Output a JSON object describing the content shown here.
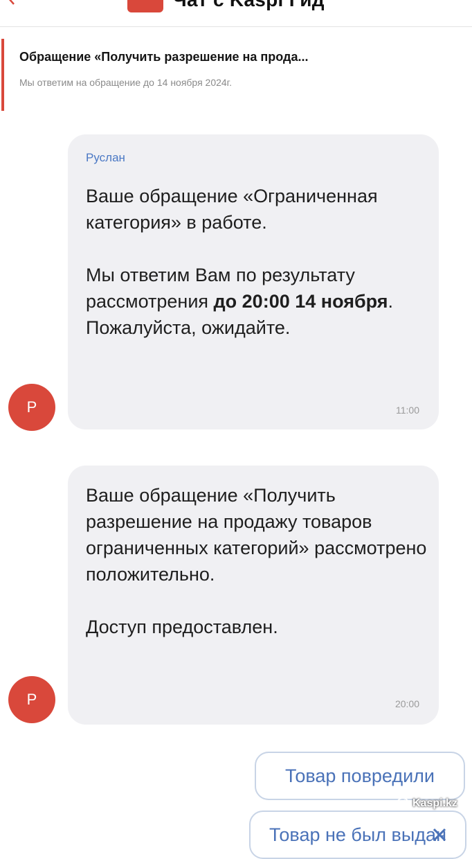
{
  "header": {
    "title": "Чат с Kaspi Гид",
    "back_icon": "arrow-back-icon",
    "chat_icon": "chat-bubble-icon"
  },
  "appeal": {
    "title": "Обращение «Получить разрешение на прода...",
    "subtitle": "Мы ответим на обращение до 14 ноября 2024г."
  },
  "messages": [
    {
      "sender": "Руслан",
      "avatar_letter": "Р",
      "line1": "Ваше обращение «Ограниченная категория» в работе.",
      "line2_start": "Мы ответим Вам по результату рассмотрения ",
      "line2_bold": "до 20:00 14 ноября",
      "line2_end": ".",
      "line3": "Пожалуйста, ожидайте.",
      "time": "11:00"
    },
    {
      "avatar_letter": "Р",
      "line1": "Ваше обращение «Получить разрешение на продажу товаров ограниченных категорий» рассмотрено положительно.",
      "line2": "Доступ предоставлен.",
      "time": "20:00"
    }
  ],
  "quick_replies": [
    {
      "label": "Товар повредили"
    },
    {
      "label": "Товар не был выдан",
      "icon": "close-icon"
    }
  ],
  "watermark": {
    "text": "Kaspi.kz"
  },
  "colors": {
    "accent": "#d9483b",
    "link": "#4a78c4",
    "bubble": "#f0f0f3"
  }
}
